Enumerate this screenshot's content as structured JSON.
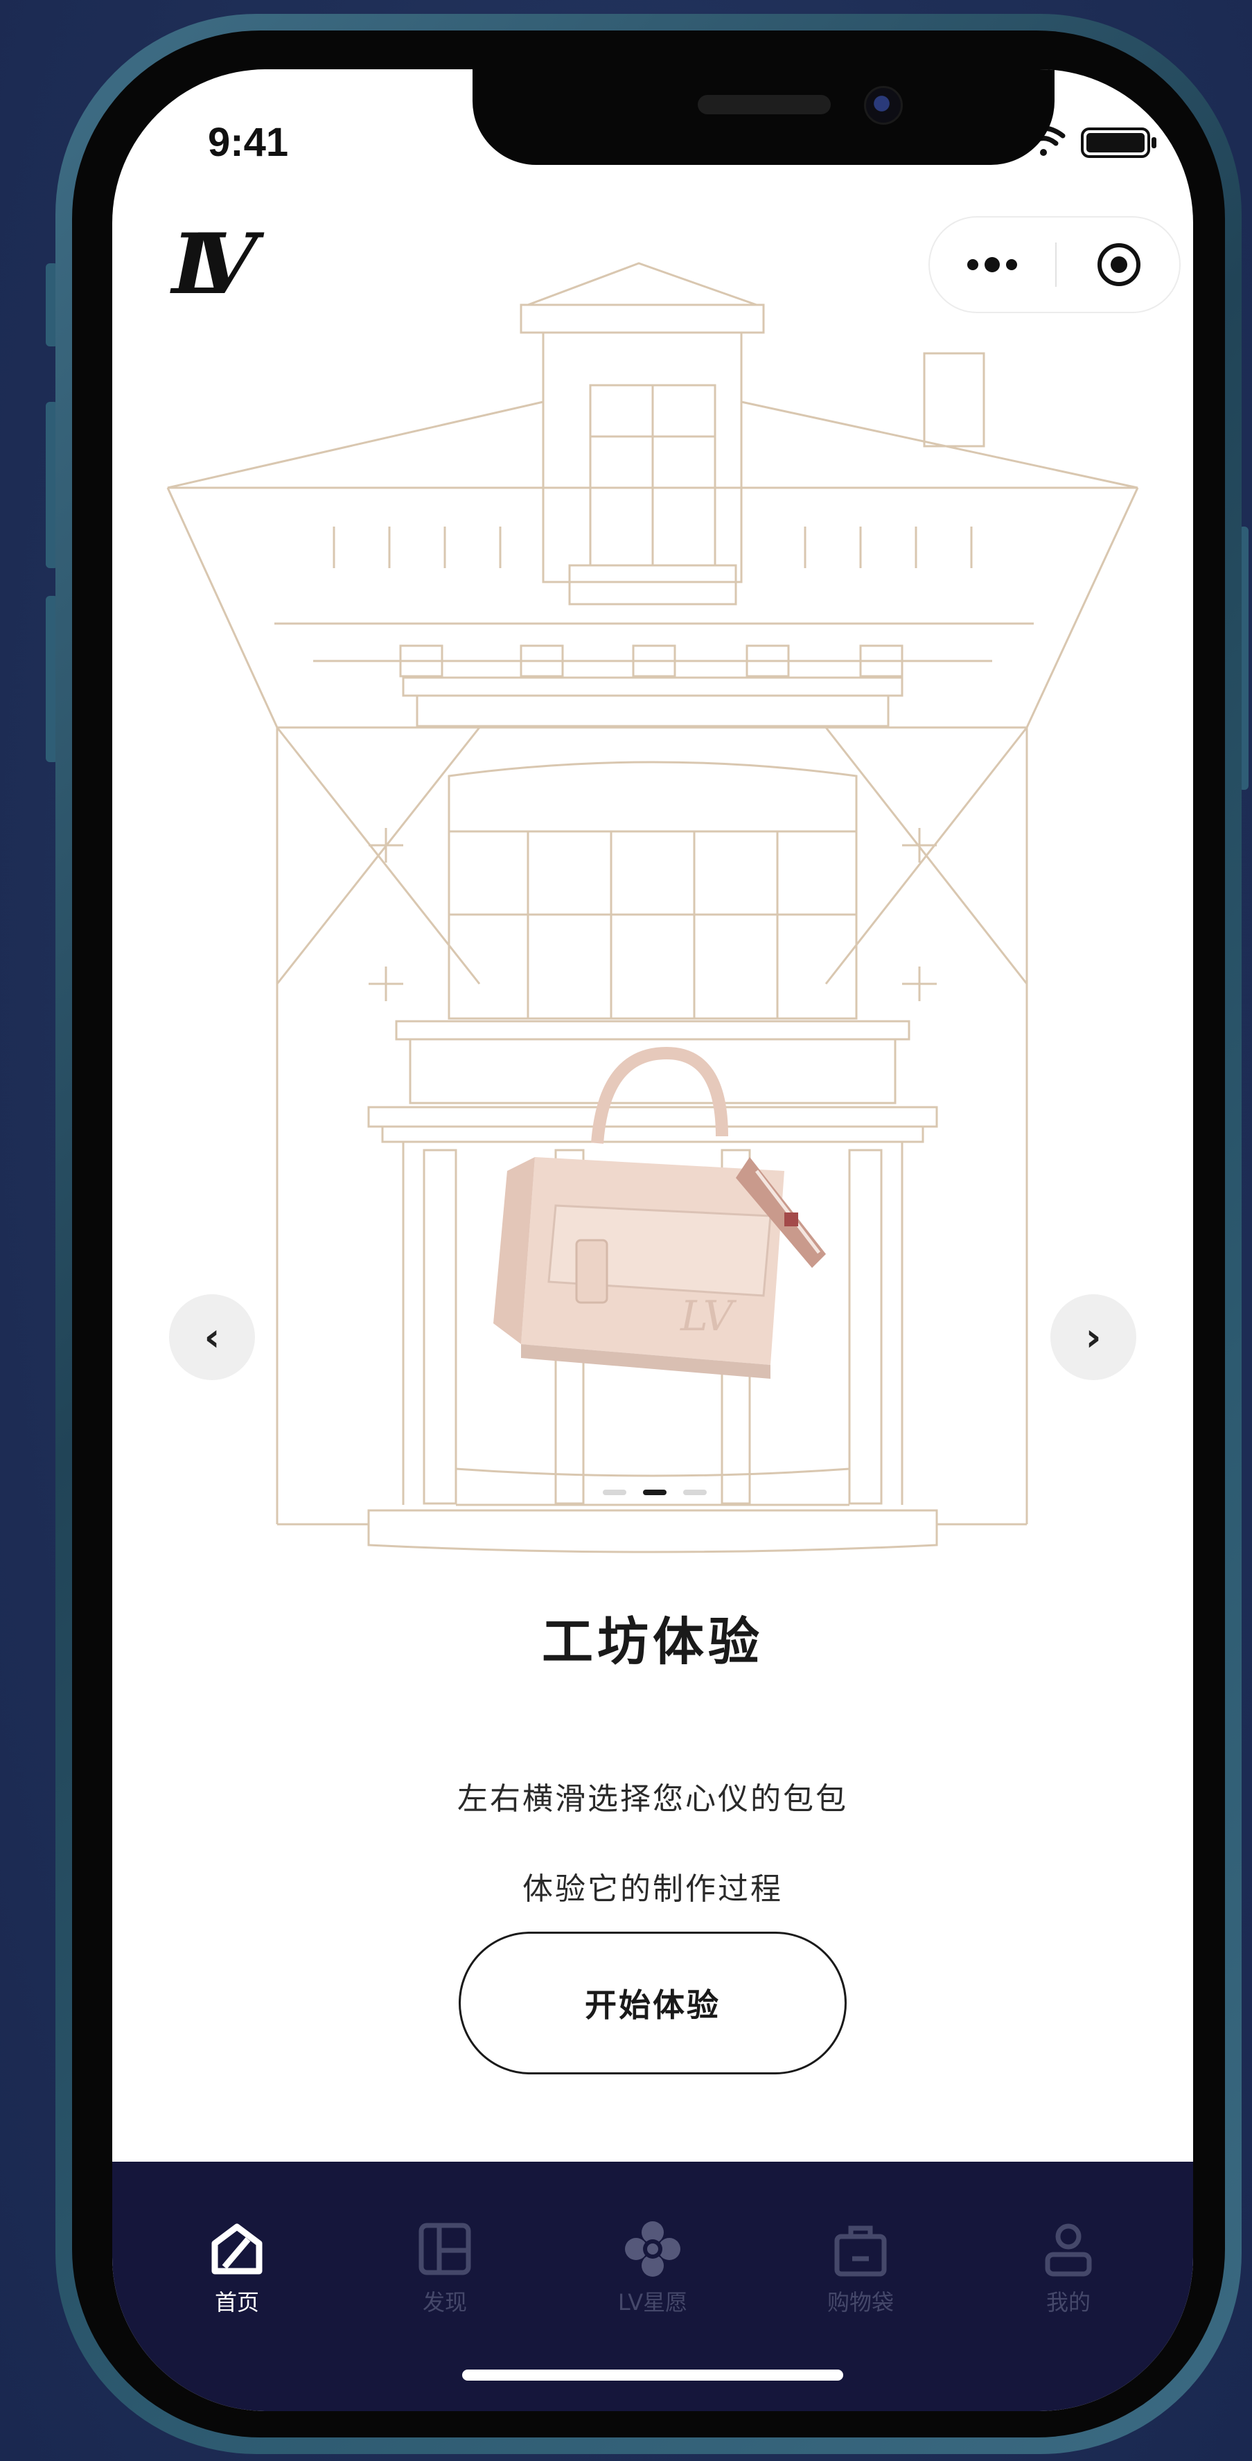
{
  "status_bar": {
    "time": "9:41"
  },
  "header": {
    "logo": "LV",
    "capsule_more_icon": "more-dots-icon",
    "capsule_close_icon": "target-circle-icon"
  },
  "carousel": {
    "prev_label": "‹",
    "next_label": "›",
    "page_count": 3,
    "active_page": 2
  },
  "content": {
    "title": "工坊体验",
    "line1": "左右横滑选择您心仪的包包",
    "line2": "体验它的制作过程",
    "cta": "开始体验"
  },
  "tabbar": {
    "items": [
      {
        "label": "首页",
        "icon": "home-icon",
        "active": true
      },
      {
        "label": "发现",
        "icon": "grid-icon",
        "active": false
      },
      {
        "label": "LV星愿",
        "icon": "monogram-flower-icon",
        "active": false
      },
      {
        "label": "购物袋",
        "icon": "shopping-bag-icon",
        "active": false
      },
      {
        "label": "我的",
        "icon": "user-icon",
        "active": false
      }
    ]
  },
  "colors": {
    "backdrop": "#1f2f57",
    "building_line": "#d9c7b0",
    "tabbar": "#15163b",
    "bag": "#efd8cc"
  }
}
